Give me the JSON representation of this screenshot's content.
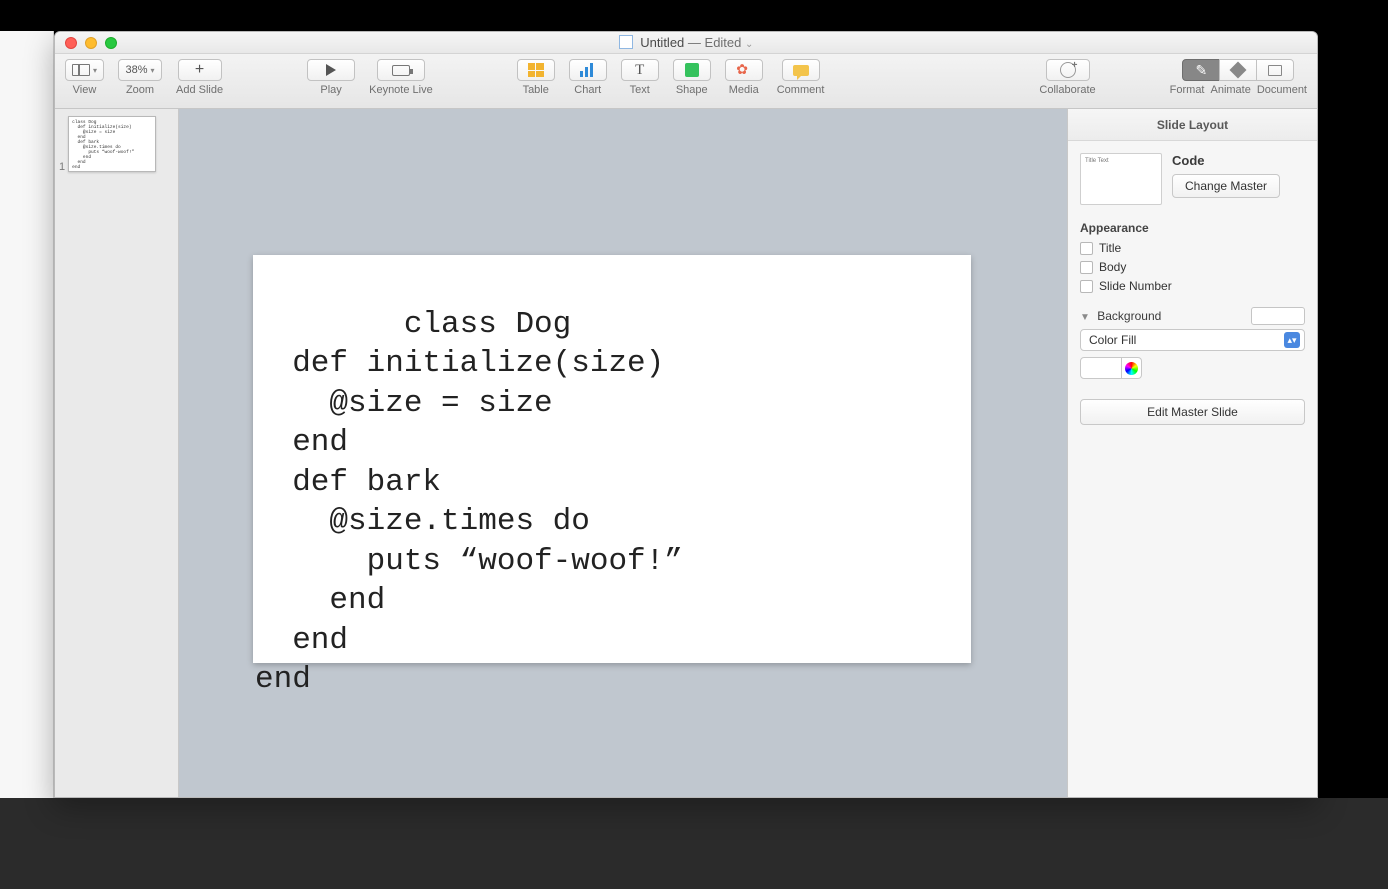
{
  "window": {
    "title_doc": "Untitled",
    "title_state": "— Edited"
  },
  "toolbar": {
    "view": "View",
    "zoom_label": "Zoom",
    "zoom_value": "38%",
    "add_slide": "Add Slide",
    "play": "Play",
    "keynote_live": "Keynote Live",
    "table": "Table",
    "chart": "Chart",
    "text": "Text",
    "shape": "Shape",
    "media": "Media",
    "comment": "Comment",
    "collaborate": "Collaborate",
    "format": "Format",
    "animate": "Animate",
    "document": "Document"
  },
  "thumbnails": {
    "items": [
      {
        "index": "1"
      }
    ]
  },
  "slide": {
    "code": "class Dog\n  def initialize(size)\n    @size = size\n  end\n  def bark\n    @size.times do\n      puts “woof-woof!”\n    end\n  end\nend"
  },
  "inspector": {
    "header": "Slide Layout",
    "master_preview_label": "Title Text",
    "master_name": "Code",
    "change_master": "Change Master",
    "appearance_label": "Appearance",
    "chk_title": "Title",
    "chk_body": "Body",
    "chk_slidenum": "Slide Number",
    "background_label": "Background",
    "fill_type": "Color Fill",
    "edit_master": "Edit Master Slide"
  }
}
